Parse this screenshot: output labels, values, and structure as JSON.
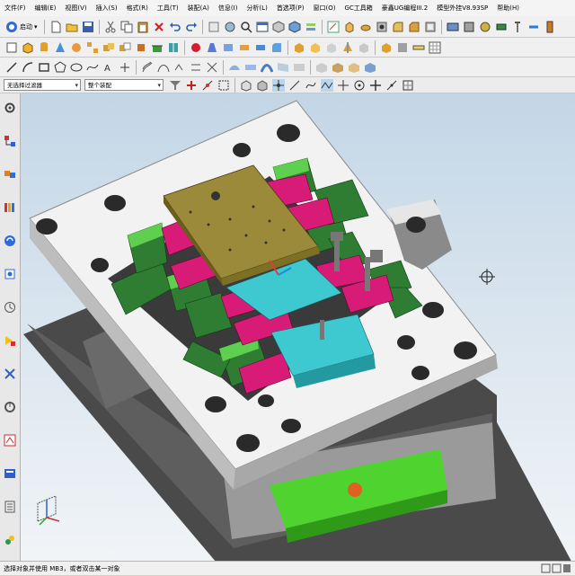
{
  "menubar": {
    "items": [
      "文件(F)",
      "编辑(E)",
      "视图(V)",
      "插入(S)",
      "格式(R)",
      "工具(T)",
      "装配(A)",
      "信息(I)",
      "分析(L)",
      "首选项(P)",
      "窗口(O)",
      "GC工具箱",
      "豪鑫UG编程III.2",
      "模型外挂V8.93SP",
      "帮助(H)"
    ]
  },
  "toolbar": {
    "start_label": "启动"
  },
  "selection_bar": {
    "filter_value": "无选择过滤器",
    "scope_value": "整个装配"
  },
  "status": {
    "message": "选择对象并使用 MB3，或者双击某一对象"
  },
  "colors": {
    "accent": "#e53935",
    "mold_plate": "#f2f2f2",
    "core_insert": "#3ec8cf",
    "slider": "#2e7d32",
    "lifter": "#d81b77",
    "ejector_plate": "#58d33a"
  },
  "icons": [
    "ug-logo-icon",
    "start-icon",
    "new-file-icon",
    "open-file-icon",
    "save-icon",
    "cut-icon",
    "copy-icon",
    "paste-icon",
    "undo-icon",
    "redo-icon",
    "command-finder-icon",
    "window-icon",
    "view-orient-icon",
    "render-style-icon",
    "crosshair-cursor-icon",
    "wcs-triad-icon"
  ]
}
